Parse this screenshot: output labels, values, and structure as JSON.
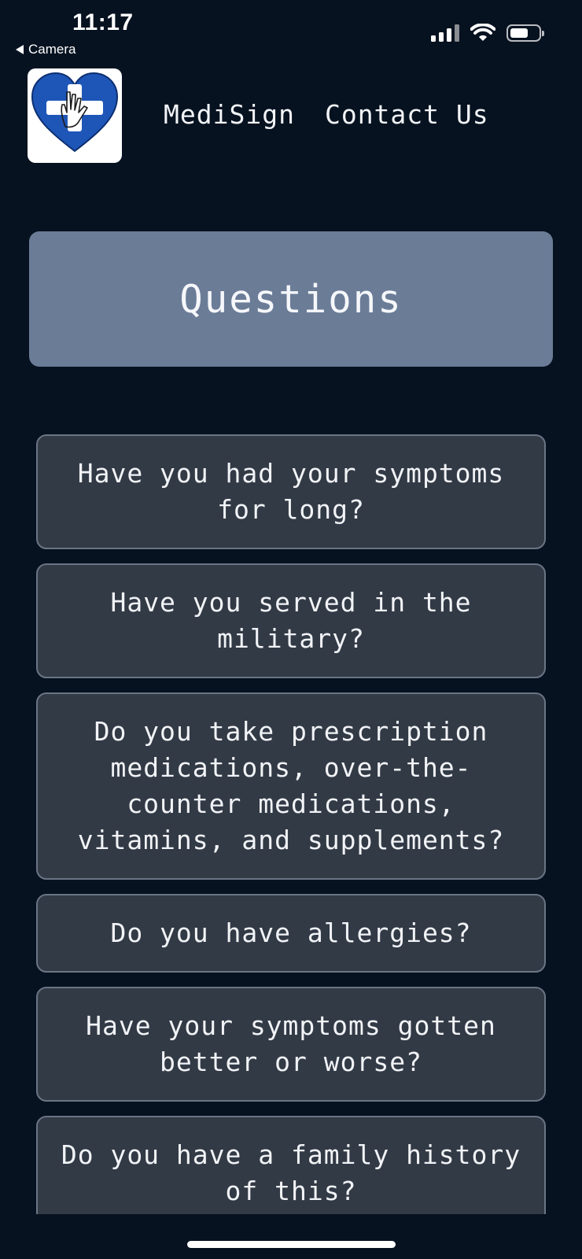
{
  "status_bar": {
    "time": "11:17",
    "back_label": "Camera"
  },
  "header": {
    "nav": [
      {
        "label": "MediSign"
      },
      {
        "label": "Contact Us"
      }
    ]
  },
  "page": {
    "title": "Questions"
  },
  "questions": [
    {
      "text": "Have you had your symptoms for long?"
    },
    {
      "text": "Have you served in the military?"
    },
    {
      "text": "Do you take prescription medications, over-the-counter medications, vitamins, and supplements?"
    },
    {
      "text": "Do you have allergies?"
    },
    {
      "text": "Have your symptoms gotten better or worse?"
    },
    {
      "text": "Do you have a family history of this?"
    }
  ],
  "colors": {
    "background": "#061220",
    "title_box": "#6b7c97",
    "card": "#323a46",
    "card_border": "#6a7485",
    "logo_blue": "#1e56b8"
  }
}
